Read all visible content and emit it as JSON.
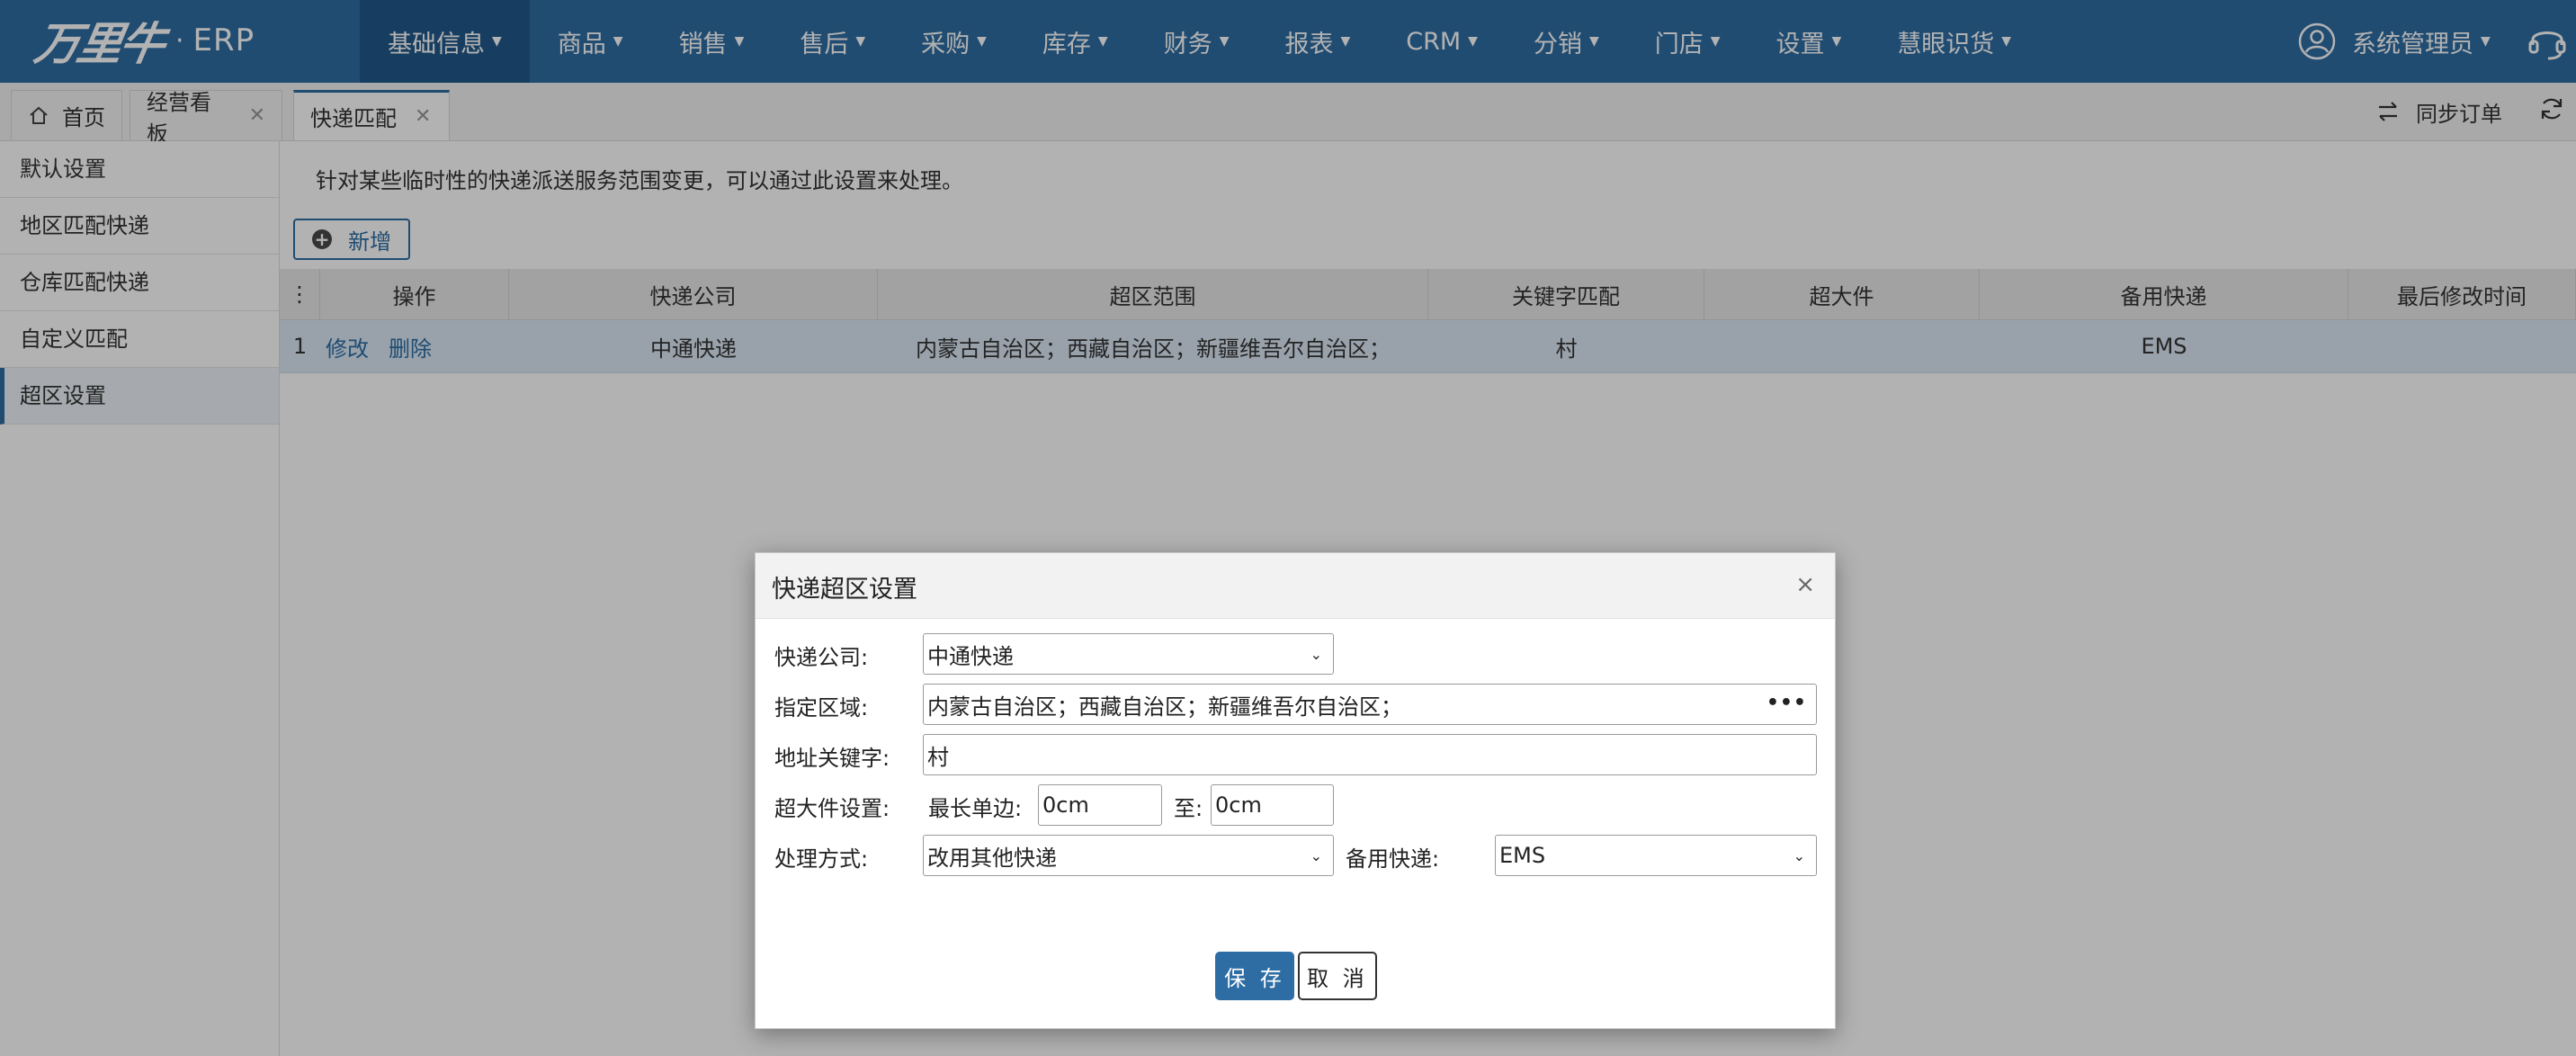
{
  "app": {
    "logo_text": "万里牛",
    "logo_dot": "·",
    "logo_suffix": "ERP"
  },
  "nav": [
    {
      "label": "基础信息",
      "active": true
    },
    {
      "label": "商品"
    },
    {
      "label": "销售"
    },
    {
      "label": "售后"
    },
    {
      "label": "采购"
    },
    {
      "label": "库存"
    },
    {
      "label": "财务"
    },
    {
      "label": "报表"
    },
    {
      "label": "CRM"
    },
    {
      "label": "分销"
    },
    {
      "label": "门店"
    },
    {
      "label": "设置"
    },
    {
      "label": "慧眼识货"
    }
  ],
  "user": {
    "name": "系统管理员"
  },
  "tabs": [
    {
      "label": "首页"
    },
    {
      "label": "经营看板"
    },
    {
      "label": "快递匹配",
      "active": true
    }
  ],
  "toolbar": {
    "sync_label": "同步订单"
  },
  "sidebar": {
    "items": [
      {
        "label": "默认设置"
      },
      {
        "label": "地区匹配快递"
      },
      {
        "label": "仓库匹配快递"
      },
      {
        "label": "自定义匹配"
      },
      {
        "label": "超区设置",
        "active": true
      }
    ]
  },
  "main": {
    "notice": "针对某些临时性的快递派送服务范围变更，可以通过此设置来处理。",
    "add_label": "新增",
    "table": {
      "headers": [
        "操作",
        "快递公司",
        "超区范围",
        "关键字匹配",
        "超大件",
        "备用快递",
        "最后修改时间"
      ],
      "rows": [
        {
          "index": "1",
          "edit": "修改",
          "delete": "删除",
          "company": "中通快递",
          "range": "内蒙古自治区；西藏自治区；新疆维吾尔自治区；",
          "keyword": "村",
          "oversize": "",
          "backup": "EMS",
          "modified": ""
        }
      ]
    }
  },
  "modal": {
    "title": "快递超区设置",
    "close": "×",
    "company_label": "快递公司:",
    "company_value": "中通快递",
    "area_label": "指定区域:",
    "area_value": "内蒙古自治区；西藏自治区；新疆维吾尔自治区；",
    "keyword_label": "地址关键字:",
    "keyword_value": "村",
    "oversize_label": "超大件设置:",
    "max_side_label": "最长单边:",
    "from_value": "0cm",
    "to_label": "至:",
    "to_value": "0cm",
    "handle_label": "处理方式:",
    "handle_value": "改用其他快递",
    "backup_label": "备用快递:",
    "backup_value": "EMS",
    "save_label": "保 存",
    "cancel_label": "取 消"
  },
  "colors": {
    "primary": "#2e6da4",
    "nav_active": "#215a8c",
    "row_selected": "#dbe8f5"
  }
}
